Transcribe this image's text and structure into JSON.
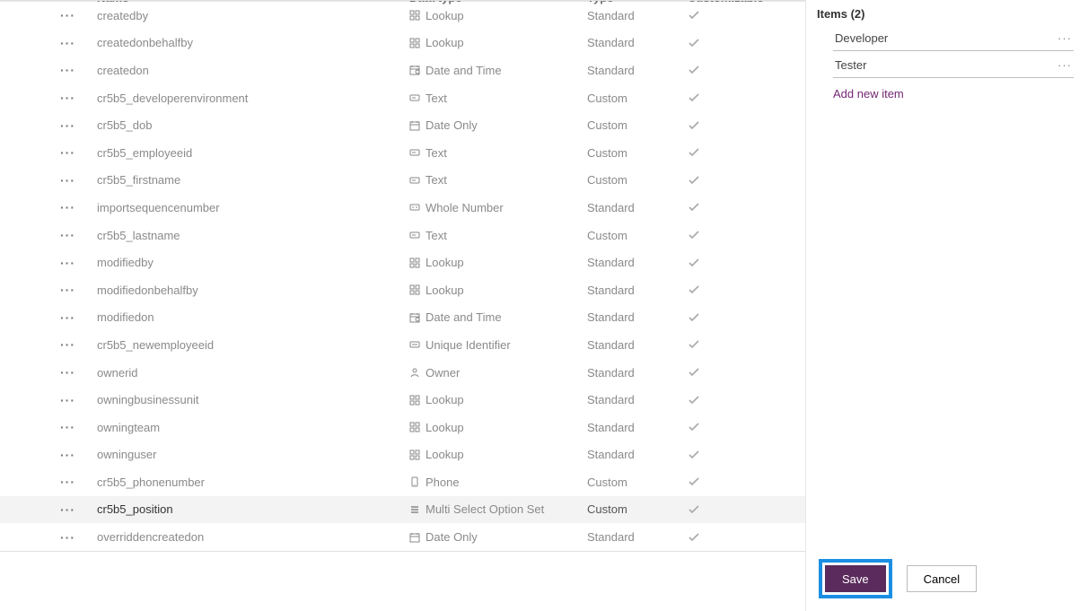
{
  "columns": {
    "name": "Name",
    "datatype": "Data type",
    "type": "Type",
    "customizable": "Customizable"
  },
  "rows": [
    {
      "name": "createdby",
      "datatype": "Lookup",
      "icon": "lookup",
      "type": "Standard",
      "cust": true,
      "selected": false
    },
    {
      "name": "createdonbehalfby",
      "datatype": "Lookup",
      "icon": "lookup",
      "type": "Standard",
      "cust": true,
      "selected": false
    },
    {
      "name": "createdon",
      "datatype": "Date and Time",
      "icon": "datetime",
      "type": "Standard",
      "cust": true,
      "selected": false
    },
    {
      "name": "cr5b5_developerenvironment",
      "datatype": "Text",
      "icon": "text",
      "type": "Custom",
      "cust": true,
      "selected": false
    },
    {
      "name": "cr5b5_dob",
      "datatype": "Date Only",
      "icon": "date",
      "type": "Custom",
      "cust": true,
      "selected": false
    },
    {
      "name": "cr5b5_employeeid",
      "datatype": "Text",
      "icon": "text",
      "type": "Custom",
      "cust": true,
      "selected": false
    },
    {
      "name": "cr5b5_firstname",
      "datatype": "Text",
      "icon": "text",
      "type": "Custom",
      "cust": true,
      "selected": false
    },
    {
      "name": "importsequencenumber",
      "datatype": "Whole Number",
      "icon": "number",
      "type": "Standard",
      "cust": true,
      "selected": false
    },
    {
      "name": "cr5b5_lastname",
      "datatype": "Text",
      "icon": "text",
      "type": "Custom",
      "cust": true,
      "selected": false
    },
    {
      "name": "modifiedby",
      "datatype": "Lookup",
      "icon": "lookup",
      "type": "Standard",
      "cust": true,
      "selected": false
    },
    {
      "name": "modifiedonbehalfby",
      "datatype": "Lookup",
      "icon": "lookup",
      "type": "Standard",
      "cust": true,
      "selected": false
    },
    {
      "name": "modifiedon",
      "datatype": "Date and Time",
      "icon": "datetime",
      "type": "Standard",
      "cust": true,
      "selected": false
    },
    {
      "name": "cr5b5_newemployeeid",
      "datatype": "Unique Identifier",
      "icon": "uid",
      "type": "Standard",
      "cust": true,
      "selected": false
    },
    {
      "name": "ownerid",
      "datatype": "Owner",
      "icon": "owner",
      "type": "Standard",
      "cust": true,
      "selected": false
    },
    {
      "name": "owningbusinessunit",
      "datatype": "Lookup",
      "icon": "lookup",
      "type": "Standard",
      "cust": true,
      "selected": false
    },
    {
      "name": "owningteam",
      "datatype": "Lookup",
      "icon": "lookup",
      "type": "Standard",
      "cust": true,
      "selected": false
    },
    {
      "name": "owninguser",
      "datatype": "Lookup",
      "icon": "lookup",
      "type": "Standard",
      "cust": true,
      "selected": false
    },
    {
      "name": "cr5b5_phonenumber",
      "datatype": "Phone",
      "icon": "phone",
      "type": "Custom",
      "cust": true,
      "selected": false
    },
    {
      "name": "cr5b5_position",
      "datatype": "Multi Select Option Set",
      "icon": "multiselect",
      "type": "Custom",
      "cust": true,
      "selected": true
    },
    {
      "name": "overriddencreatedon",
      "datatype": "Date Only",
      "icon": "date",
      "type": "Standard",
      "cust": true,
      "selected": false
    }
  ],
  "panel": {
    "title": "Items (2)",
    "items": [
      "Developer",
      "Tester"
    ],
    "add": "Add new item",
    "save": "Save",
    "cancel": "Cancel"
  }
}
